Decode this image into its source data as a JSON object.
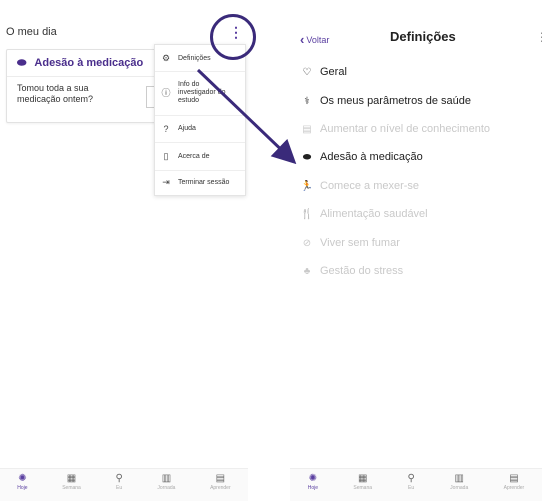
{
  "left": {
    "title": "O meu dia",
    "kebab": "⋮",
    "card": {
      "header": "Adesão à medicação",
      "question": "Tomou toda a sua medicação ontem?"
    },
    "menu": [
      {
        "icon": "⚙",
        "label": "Definições"
      },
      {
        "icon": "ⓘ",
        "label": "Info do investigador do estudo"
      },
      {
        "icon": "?",
        "label": "Ajuda"
      },
      {
        "icon": "▯",
        "label": "Acerca de"
      },
      {
        "icon": "⇥",
        "label": "Terminar sessão"
      }
    ],
    "tabs": [
      {
        "label": "Hoje",
        "icon": "✺"
      },
      {
        "label": "Semana",
        "icon": "▦"
      },
      {
        "label": "Eu",
        "icon": "⚲"
      },
      {
        "label": "Jornada",
        "icon": "▥"
      },
      {
        "label": "Aprender",
        "icon": "▤"
      }
    ]
  },
  "right": {
    "back_label": "Voltar",
    "title": "Definições",
    "more": "⋮",
    "items": [
      {
        "icon": "♡",
        "label": "Geral",
        "enabled": true
      },
      {
        "icon": "⚕",
        "label": "Os meus parâmetros de saúde",
        "enabled": true
      },
      {
        "icon": "▤",
        "label": "Aumentar o nível de conhecimento",
        "enabled": false
      },
      {
        "icon": "⬬",
        "label": "Adesão à medicação",
        "enabled": true
      },
      {
        "icon": "🏃",
        "label": "Comece a mexer-se",
        "enabled": false
      },
      {
        "icon": "🍴",
        "label": "Alimentação saudável",
        "enabled": false
      },
      {
        "icon": "⊘",
        "label": "Viver sem fumar",
        "enabled": false
      },
      {
        "icon": "♣",
        "label": "Gestão do stress",
        "enabled": false
      }
    ],
    "tabs": [
      {
        "label": "Hoje",
        "icon": "✺"
      },
      {
        "label": "Semana",
        "icon": "▦"
      },
      {
        "label": "Eu",
        "icon": "⚲"
      },
      {
        "label": "Jornada",
        "icon": "▥"
      },
      {
        "label": "Aprender",
        "icon": "▤"
      }
    ]
  },
  "colors": {
    "accent": "#5a3fa0",
    "annotation": "#3a2a7a",
    "disabled": "#c9c9c9"
  }
}
